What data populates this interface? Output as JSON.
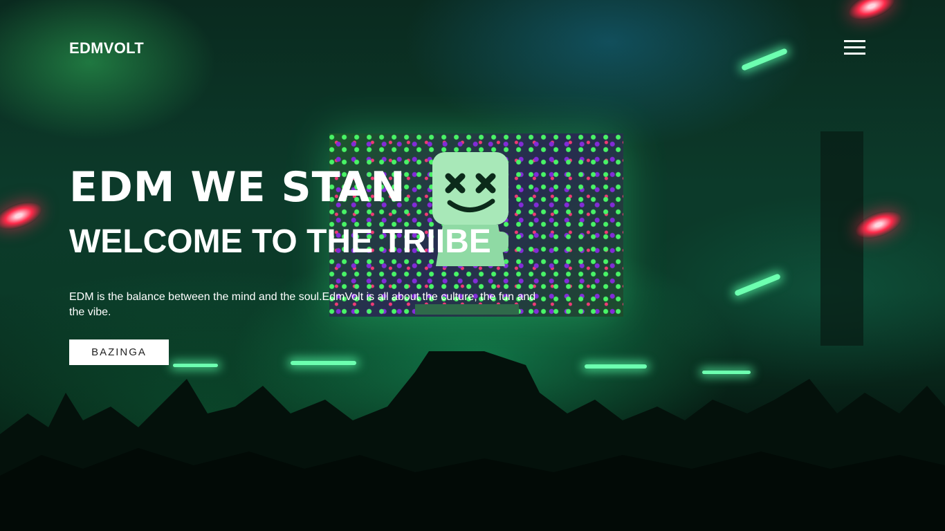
{
  "header": {
    "logo": "EDMVOLT",
    "menu_icon": "hamburger-menu-icon"
  },
  "hero": {
    "headline": "EDM WE STAN",
    "subheadline": "WELCOME TO THE TRIIBE",
    "description": "EDM is the balance between the mind and the soul.EdmVolt is all about the culture, the fun and the vibe.",
    "cta_label": "BAZINGA"
  },
  "colors": {
    "text": "#ffffff",
    "button_bg": "#ffffff",
    "button_text": "#222222",
    "background_tint": "#0c3a2a"
  }
}
